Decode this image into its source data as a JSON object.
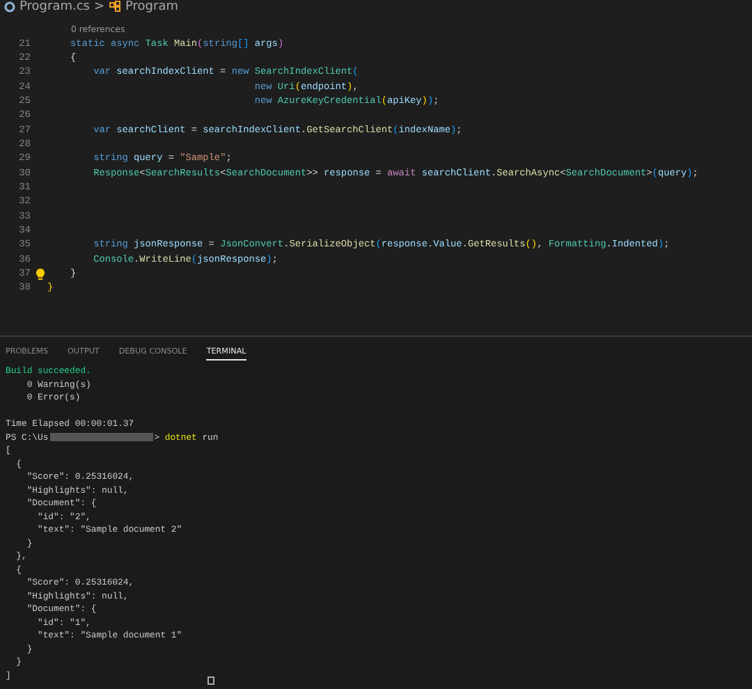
{
  "breadcrumb": {
    "file": "Program.cs",
    "separator": ">",
    "symbol": "Program"
  },
  "editor": {
    "lines": [
      {
        "kind": "codelens",
        "text": "0 references"
      },
      {
        "kind": "code",
        "number": "21",
        "lightbulb": false,
        "tokens": [
          {
            "text": "    static async ",
            "kind": "keyword"
          },
          {
            "text": "Task ",
            "kind": "type"
          },
          {
            "text": "Main",
            "kind": "method"
          },
          {
            "text": "(",
            "kind": "bracket2"
          },
          {
            "text": "string",
            "kind": "keyword"
          },
          {
            "text": "[]",
            "kind": "bracket3"
          },
          {
            "text": " args",
            "kind": "variable"
          },
          {
            "text": ")",
            "kind": "bracket2"
          }
        ]
      },
      {
        "kind": "code",
        "number": "22",
        "lightbulb": false,
        "tokens": [
          {
            "text": "    {",
            "kind": "plain"
          }
        ]
      },
      {
        "kind": "code",
        "number": "23",
        "lightbulb": false,
        "tokens": [
          {
            "text": "        var ",
            "kind": "keyword"
          },
          {
            "text": "searchIndexClient",
            "kind": "variable"
          },
          {
            "text": " = ",
            "kind": "plain"
          },
          {
            "text": "new ",
            "kind": "keyword"
          },
          {
            "text": "SearchIndexClient",
            "kind": "type"
          },
          {
            "text": "(",
            "kind": "bracket3"
          }
        ]
      },
      {
        "kind": "code",
        "number": "24",
        "lightbulb": false,
        "tokens": [
          {
            "text": "                                    new ",
            "kind": "keyword"
          },
          {
            "text": "Uri",
            "kind": "type"
          },
          {
            "text": "(",
            "kind": "bracket1"
          },
          {
            "text": "endpoint",
            "kind": "variable"
          },
          {
            "text": ")",
            "kind": "bracket1"
          },
          {
            "text": ",",
            "kind": "plain"
          }
        ]
      },
      {
        "kind": "code",
        "number": "25",
        "lightbulb": false,
        "tokens": [
          {
            "text": "                                    new ",
            "kind": "keyword"
          },
          {
            "text": "AzureKeyCredential",
            "kind": "type"
          },
          {
            "text": "(",
            "kind": "bracket1"
          },
          {
            "text": "apiKey",
            "kind": "variable"
          },
          {
            "text": ")",
            "kind": "bracket1"
          },
          {
            "text": ")",
            "kind": "bracket3"
          },
          {
            "text": ";",
            "kind": "plain"
          }
        ]
      },
      {
        "kind": "code",
        "number": "26",
        "lightbulb": false
      },
      {
        "kind": "code",
        "number": "27",
        "lightbulb": false,
        "tokens": [
          {
            "text": "        var ",
            "kind": "keyword"
          },
          {
            "text": "searchClient",
            "kind": "variable"
          },
          {
            "text": " = ",
            "kind": "plain"
          },
          {
            "text": "searchIndexClient",
            "kind": "variable"
          },
          {
            "text": ".",
            "kind": "plain"
          },
          {
            "text": "GetSearchClient",
            "kind": "method"
          },
          {
            "text": "(",
            "kind": "bracket3"
          },
          {
            "text": "indexName",
            "kind": "variable"
          },
          {
            "text": ")",
            "kind": "bracket3"
          },
          {
            "text": ";",
            "kind": "plain"
          }
        ]
      },
      {
        "kind": "code",
        "number": "28",
        "lightbulb": false
      },
      {
        "kind": "code",
        "number": "29",
        "lightbulb": false,
        "tokens": [
          {
            "text": "        string ",
            "kind": "keyword"
          },
          {
            "text": "query",
            "kind": "variable"
          },
          {
            "text": " = ",
            "kind": "plain"
          },
          {
            "text": "\"Sample\"",
            "kind": "string"
          },
          {
            "text": ";",
            "kind": "plain"
          }
        ]
      },
      {
        "kind": "code",
        "number": "30",
        "lightbulb": false,
        "tokens": [
          {
            "text": "        Response",
            "kind": "type"
          },
          {
            "text": "<",
            "kind": "plain"
          },
          {
            "text": "SearchResults",
            "kind": "type"
          },
          {
            "text": "<",
            "kind": "plain"
          },
          {
            "text": "SearchDocument",
            "kind": "type"
          },
          {
            "text": ">> ",
            "kind": "plain"
          },
          {
            "text": "response",
            "kind": "variable"
          },
          {
            "text": " = ",
            "kind": "plain"
          },
          {
            "text": "await ",
            "kind": "control"
          },
          {
            "text": "searchClient",
            "kind": "variable"
          },
          {
            "text": ".",
            "kind": "plain"
          },
          {
            "text": "SearchAsync",
            "kind": "method"
          },
          {
            "text": "<",
            "kind": "plain"
          },
          {
            "text": "SearchDocument",
            "kind": "type"
          },
          {
            "text": ">",
            "kind": "plain"
          },
          {
            "text": "(",
            "kind": "bracket3"
          },
          {
            "text": "query",
            "kind": "variable"
          },
          {
            "text": ")",
            "kind": "bracket3"
          },
          {
            "text": ";",
            "kind": "plain"
          }
        ]
      },
      {
        "kind": "code",
        "number": "31",
        "lightbulb": false
      },
      {
        "kind": "code",
        "number": "32",
        "lightbulb": false
      },
      {
        "kind": "code",
        "number": "33",
        "lightbulb": false
      },
      {
        "kind": "code",
        "number": "34",
        "lightbulb": false
      },
      {
        "kind": "code",
        "number": "35",
        "lightbulb": false,
        "tokens": [
          {
            "text": "        string ",
            "kind": "keyword"
          },
          {
            "text": "jsonResponse",
            "kind": "variable"
          },
          {
            "text": " = ",
            "kind": "plain"
          },
          {
            "text": "JsonConvert",
            "kind": "type"
          },
          {
            "text": ".",
            "kind": "plain"
          },
          {
            "text": "SerializeObject",
            "kind": "method"
          },
          {
            "text": "(",
            "kind": "bracket3"
          },
          {
            "text": "response",
            "kind": "variable"
          },
          {
            "text": ".",
            "kind": "plain"
          },
          {
            "text": "Value",
            "kind": "variable"
          },
          {
            "text": ".",
            "kind": "plain"
          },
          {
            "text": "GetResults",
            "kind": "method"
          },
          {
            "text": "()",
            "kind": "bracket1"
          },
          {
            "text": ", ",
            "kind": "plain"
          },
          {
            "text": "Formatting",
            "kind": "type"
          },
          {
            "text": ".",
            "kind": "plain"
          },
          {
            "text": "Indented",
            "kind": "variable"
          },
          {
            "text": ")",
            "kind": "bracket3"
          },
          {
            "text": ";",
            "kind": "plain"
          }
        ]
      },
      {
        "kind": "code",
        "number": "36",
        "lightbulb": false,
        "tokens": [
          {
            "text": "        Console",
            "kind": "type"
          },
          {
            "text": ".",
            "kind": "plain"
          },
          {
            "text": "WriteLine",
            "kind": "method"
          },
          {
            "text": "(",
            "kind": "bracket3"
          },
          {
            "text": "jsonResponse",
            "kind": "variable"
          },
          {
            "text": ")",
            "kind": "bracket3"
          },
          {
            "text": ";",
            "kind": "plain"
          }
        ]
      },
      {
        "kind": "code",
        "number": "37",
        "lightbulb": true,
        "tokens": [
          {
            "text": "    }",
            "kind": "plain"
          }
        ]
      },
      {
        "kind": "code",
        "number": "38",
        "lightbulb": false,
        "tokens": [
          {
            "text": "}",
            "kind": "bracket1"
          }
        ]
      }
    ]
  },
  "panel": {
    "tabs": [
      {
        "label": "PROBLEMS",
        "selected": false
      },
      {
        "label": "OUTPUT",
        "selected": false
      },
      {
        "label": "DEBUG CONSOLE",
        "selected": false
      },
      {
        "label": "TERMINAL",
        "selected": true
      }
    ],
    "terminal": [
      {
        "kind": "success",
        "text": "Build succeeded."
      },
      {
        "kind": "output",
        "text": "    0 Warning(s)"
      },
      {
        "kind": "output",
        "text": "    0 Error(s)"
      },
      {
        "kind": "blank"
      },
      {
        "kind": "output",
        "text": "Time Elapsed 00:00:01.37"
      },
      {
        "kind": "prompt",
        "text": "PS C:\\Us",
        "symbol": ">",
        "command": "dotnet",
        "args": "run"
      },
      {
        "kind": "output",
        "text": "["
      },
      {
        "kind": "output",
        "text": "  {"
      },
      {
        "kind": "output",
        "text": "    \"Score\": 0.25316024,"
      },
      {
        "kind": "output",
        "text": "    \"Highlights\": null,"
      },
      {
        "kind": "output",
        "text": "    \"Document\": {"
      },
      {
        "kind": "output",
        "text": "      \"id\": \"2\","
      },
      {
        "kind": "output",
        "text": "      \"text\": \"Sample document 2\""
      },
      {
        "kind": "output",
        "text": "    }"
      },
      {
        "kind": "output",
        "text": "  },"
      },
      {
        "kind": "output",
        "text": "  {"
      },
      {
        "kind": "output",
        "text": "    \"Score\": 0.25316024,"
      },
      {
        "kind": "output",
        "text": "    \"Highlights\": null,"
      },
      {
        "kind": "output",
        "text": "    \"Document\": {"
      },
      {
        "kind": "output",
        "text": "      \"id\": \"1\","
      },
      {
        "kind": "output",
        "text": "      \"text\": \"Sample document 1\""
      },
      {
        "kind": "output",
        "text": "    }"
      },
      {
        "kind": "output",
        "text": "  }"
      },
      {
        "kind": "output",
        "text": "]"
      }
    ]
  }
}
